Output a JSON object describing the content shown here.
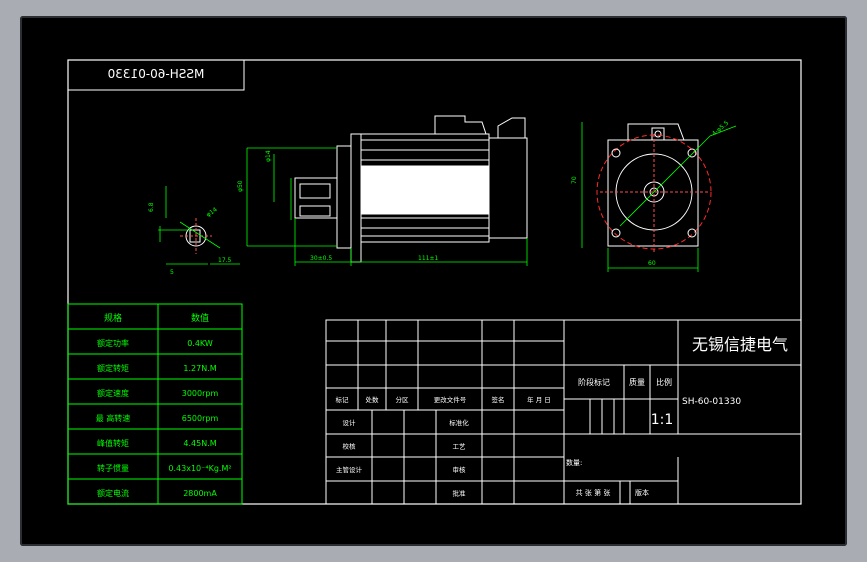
{
  "drawing": {
    "mirrored_label": "MSSH-60-01330",
    "company": "无锡信捷电气",
    "part_number": "SH-60-01330",
    "scale": "1:1"
  },
  "specs": {
    "header": {
      "param": "规格",
      "value": "数值"
    },
    "rows": [
      {
        "param": "额定功率",
        "value": "0.4KW"
      },
      {
        "param": "额定转矩",
        "value": "1.27N.M"
      },
      {
        "param": "额定速度",
        "value": "3000rpm"
      },
      {
        "param": "最 高转速",
        "value": "6500rpm"
      },
      {
        "param": "峰值转矩",
        "value": "4.45N.M"
      },
      {
        "param": "转子惯量",
        "value": "0.43x10⁻⁴Kg.M²"
      },
      {
        "param": "额定电流",
        "value": "2800mA"
      }
    ]
  },
  "title_block": {
    "rev_headers": [
      "标记",
      "处数",
      "分区",
      "更改文件号",
      "签名",
      "年 月 日"
    ],
    "sign_rows": [
      "设计",
      "校核",
      "主管设计"
    ],
    "sign_rows_mid": [
      "标准化",
      "工艺",
      "审核",
      "批准"
    ],
    "stage_label": "阶段标记",
    "weight_label": "质量",
    "ratio_label": "比例",
    "quantity_label": "数量:",
    "sheet_text": "共 张 第 张",
    "version_label": "版本"
  },
  "dims": {
    "shaft_width": "5",
    "shaft_height": "6.8",
    "shaft_dia": "φ14",
    "key_len": "17.5",
    "side_dia_big": "φ50",
    "side_dia_small": "φ14",
    "shaft_len": "30±0.5",
    "body_len": "111±1",
    "front_height": "70",
    "front_width": "60",
    "bolt_hole": "4-φ5.5"
  },
  "colors": {
    "background": "#000000",
    "lines": "#ffffff",
    "dims": "#00ff00",
    "table_text": "#00ff00",
    "circle": "#ff2a2a"
  }
}
